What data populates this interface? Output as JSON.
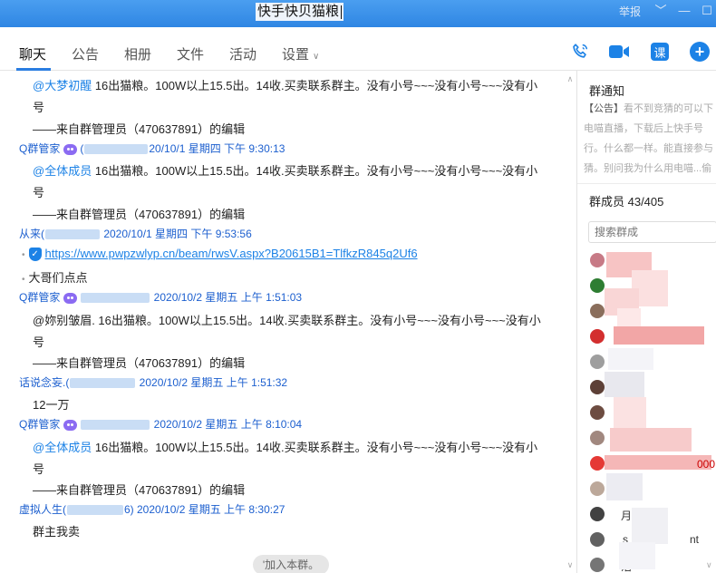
{
  "window": {
    "title": "快手快贝猫粮",
    "report_label": "举报",
    "controls": {
      "dropdown": "﹀",
      "minimize": "—",
      "maximize": "☐"
    }
  },
  "nav": {
    "tabs": [
      {
        "label": "聊天",
        "active": true
      },
      {
        "label": "公告"
      },
      {
        "label": "相册"
      },
      {
        "label": "文件"
      },
      {
        "label": "活动"
      },
      {
        "label": "设置"
      }
    ],
    "icons": {
      "ke": "课",
      "plus": "+"
    }
  },
  "chat": {
    "messages": {
      "m1": {
        "mention": "@大梦初醒",
        "text": " 16出猫粮。100W以上15.5出。14收.买卖联系群主。没有小号~~~没有小号~~~没有小",
        "text2": "号",
        "footer": "——来自群管理员（470637891）的编辑"
      },
      "m2": {
        "sender": "Q群管家",
        "sender_paren": "(",
        "time": "20/10/1 星期四 下午 9:30:13",
        "mention": "@全体成员",
        "text": " 16出猫粮。100W以上15.5出。14收.买卖联系群主。没有小号~~~没有小号~~~没有小",
        "text2": "号",
        "footer": "——来自群管理员（470637891）的编辑"
      },
      "m3": {
        "sender": "从来(",
        "time": " 2020/10/1 星期四 下午 9:53:56",
        "link": "https://www.pwpzwlyp.cn/beam/rwsV.aspx?B20615B1=TlfkzR845q2Uf6",
        "text": "大哥们点点"
      },
      "m4": {
        "sender": "Q群管家",
        "time": " 2020/10/2 星期五 上午 1:51:03",
        "text": "@妳别皱眉. 16出猫粮。100W以上15.5出。14收.买卖联系群主。没有小号~~~没有小号~~~没有小",
        "text2": "号",
        "footer": "——来自群管理员（470637891）的编辑"
      },
      "m5": {
        "sender": "话说念妄.(",
        "time": " 2020/10/2 星期五 上午 1:51:32",
        "text": "12一万"
      },
      "m6": {
        "sender": "Q群管家",
        "time": " 2020/10/2 星期五 上午 8:10:04",
        "mention": "@全体成员",
        "text": " 16出猫粮。100W以上15.5出。14收.买卖联系群主。没有小号~~~没有小号~~~没有小",
        "text2": "号",
        "footer": "——来自群管理员（470637891）的编辑"
      },
      "m7": {
        "sender": "虚拟人生(",
        "sender_tail": "6)",
        "time": " 2020/10/2 星期五 上午 8:30:27",
        "text": "群主我卖"
      }
    },
    "join_button": "'加入本群。"
  },
  "side": {
    "notice_title": "群通知",
    "notice_lines": [
      {
        "tag": "【公告】",
        "text": "看不到竞猜的可以下"
      },
      {
        "text": "电喵直播，下载后上快手号"
      },
      {
        "text": "行。什么都一样。能直接参与"
      },
      {
        "text": "猜。别问我为什么用电喵...偷"
      }
    ],
    "members_title": "群成员 43/405",
    "search_placeholder": "搜索群成",
    "member_fragments": {
      "f1": "月",
      "f2": "s",
      "f3": "nt",
      "f4": "000",
      "f5": "活"
    }
  },
  "colors": {
    "titlebar": "#2f86e3",
    "accent": "#1c82e6",
    "sender": "#1c5fcf",
    "bot_badge": "#8b6bf2"
  }
}
